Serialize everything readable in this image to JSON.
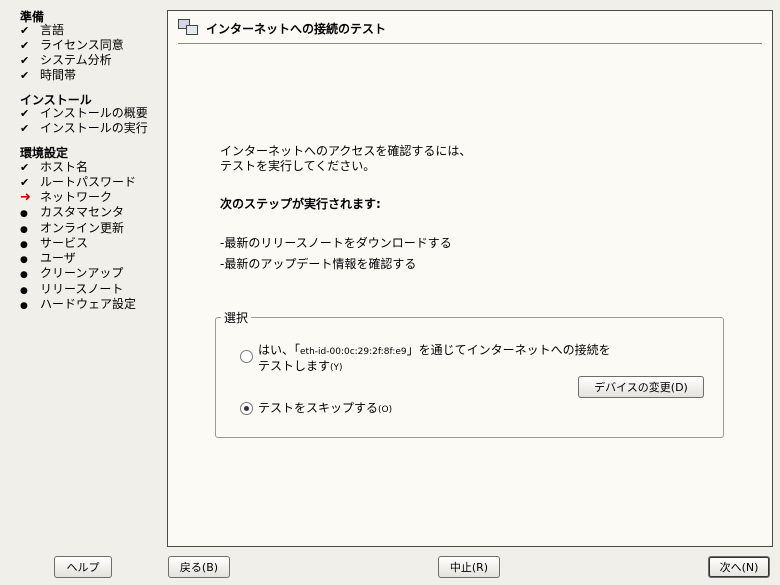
{
  "sidebar": {
    "sections": [
      {
        "title": "準備",
        "items": [
          {
            "label": "言語",
            "state": "done"
          },
          {
            "label": "ライセンス同意",
            "state": "done"
          },
          {
            "label": "システム分析",
            "state": "done"
          },
          {
            "label": "時間帯",
            "state": "done"
          }
        ]
      },
      {
        "title": "インストール",
        "items": [
          {
            "label": "インストールの概要",
            "state": "done"
          },
          {
            "label": "インストールの実行",
            "state": "done"
          }
        ]
      },
      {
        "title": "環境設定",
        "items": [
          {
            "label": "ホスト名",
            "state": "done"
          },
          {
            "label": "ルートパスワード",
            "state": "done"
          },
          {
            "label": "ネットワーク",
            "state": "current"
          },
          {
            "label": "カスタマセンタ",
            "state": "pending"
          },
          {
            "label": "オンライン更新",
            "state": "pending"
          },
          {
            "label": "サービス",
            "state": "pending"
          },
          {
            "label": "ユーザ",
            "state": "pending"
          },
          {
            "label": "クリーンアップ",
            "state": "pending"
          },
          {
            "label": "リリースノート",
            "state": "pending"
          },
          {
            "label": "ハードウェア設定",
            "state": "pending"
          }
        ]
      }
    ],
    "icons": {
      "done": "check-icon",
      "current": "arrow-right-icon",
      "pending": "bullet-icon"
    },
    "current_color": "#d40000"
  },
  "panel": {
    "title": "インターネットへの接続のテスト",
    "title_icon": "network-computers-icon",
    "intro_line1": "インターネットへのアクセスを確認するには、",
    "intro_line2": "テストを実行してください。",
    "steps_heading": "次のステップが実行されます:",
    "step1": "-最新のリリースノートをダウンロードする",
    "step2": "-最新のアップデート情報を確認する",
    "group": {
      "legend": "選択",
      "option_yes": {
        "prefix": "はい、「",
        "device": "eth-id-00:0c:29:2f:8f:e9",
        "suffix": "」を通じてインターネットへの接続を",
        "line2": "テストします",
        "accel": "(Y)",
        "selected": false
      },
      "option_skip": {
        "label": "テストをスキップする",
        "accel": "(O)",
        "selected": true
      },
      "change_device_button": "デバイスの変更(D)"
    }
  },
  "footer": {
    "help": "ヘルプ",
    "back": "戻る(B)",
    "abort": "中止(R)",
    "next": "次へ(N)"
  }
}
